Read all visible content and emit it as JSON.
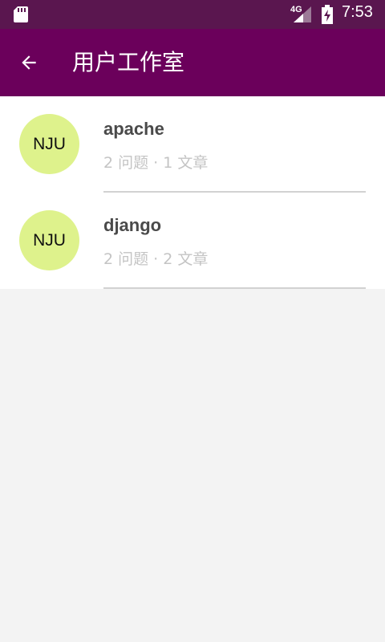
{
  "status_bar": {
    "network": "4G",
    "time": "7:53",
    "icons": [
      "sd-card-icon",
      "signal-icon",
      "battery-charging-icon"
    ]
  },
  "app_bar": {
    "title": "用户工作室",
    "back_icon": "arrow-back-icon"
  },
  "colors": {
    "status_bar": "#5a164f",
    "app_bar": "#6b005b",
    "avatar": "#def28c",
    "background": "#f3f3f3"
  },
  "studios": [
    {
      "avatar_text": "NJU",
      "name": "apache",
      "meta": "2 问题 · 1 文章"
    },
    {
      "avatar_text": "NJU",
      "name": "django",
      "meta": "2 问题 · 2 文章"
    }
  ]
}
